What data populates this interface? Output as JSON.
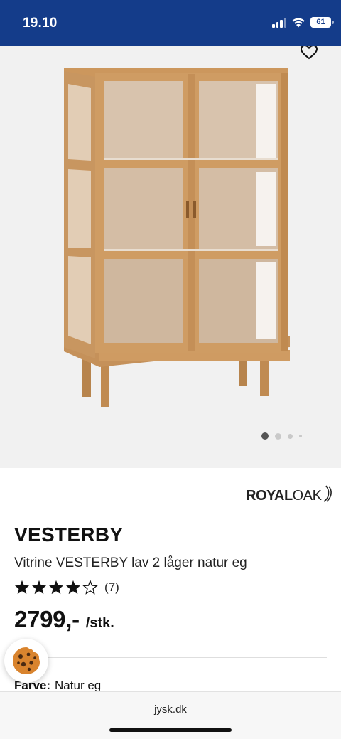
{
  "status_bar": {
    "time": "19.10",
    "battery": "61",
    "background": "#143c8a"
  },
  "gallery": {
    "total_images": 4,
    "active_index": 1,
    "wishlist_icon": "heart-outline-icon"
  },
  "brand": {
    "part1": "ROYAL",
    "part2": "OAK"
  },
  "product": {
    "name": "VESTERBY",
    "description": "Vitrine VESTERBY lav 2 låger natur eg",
    "rating_stars": 4,
    "rating_max": 5,
    "review_count": "(7)",
    "price": "2799,-",
    "price_unit": "/stk.",
    "color_label": "Farve:",
    "color_value": "Natur eg"
  },
  "browser": {
    "url": "jysk.dk"
  },
  "icons": {
    "cookie": "cookie-icon",
    "star": "star-icon"
  }
}
